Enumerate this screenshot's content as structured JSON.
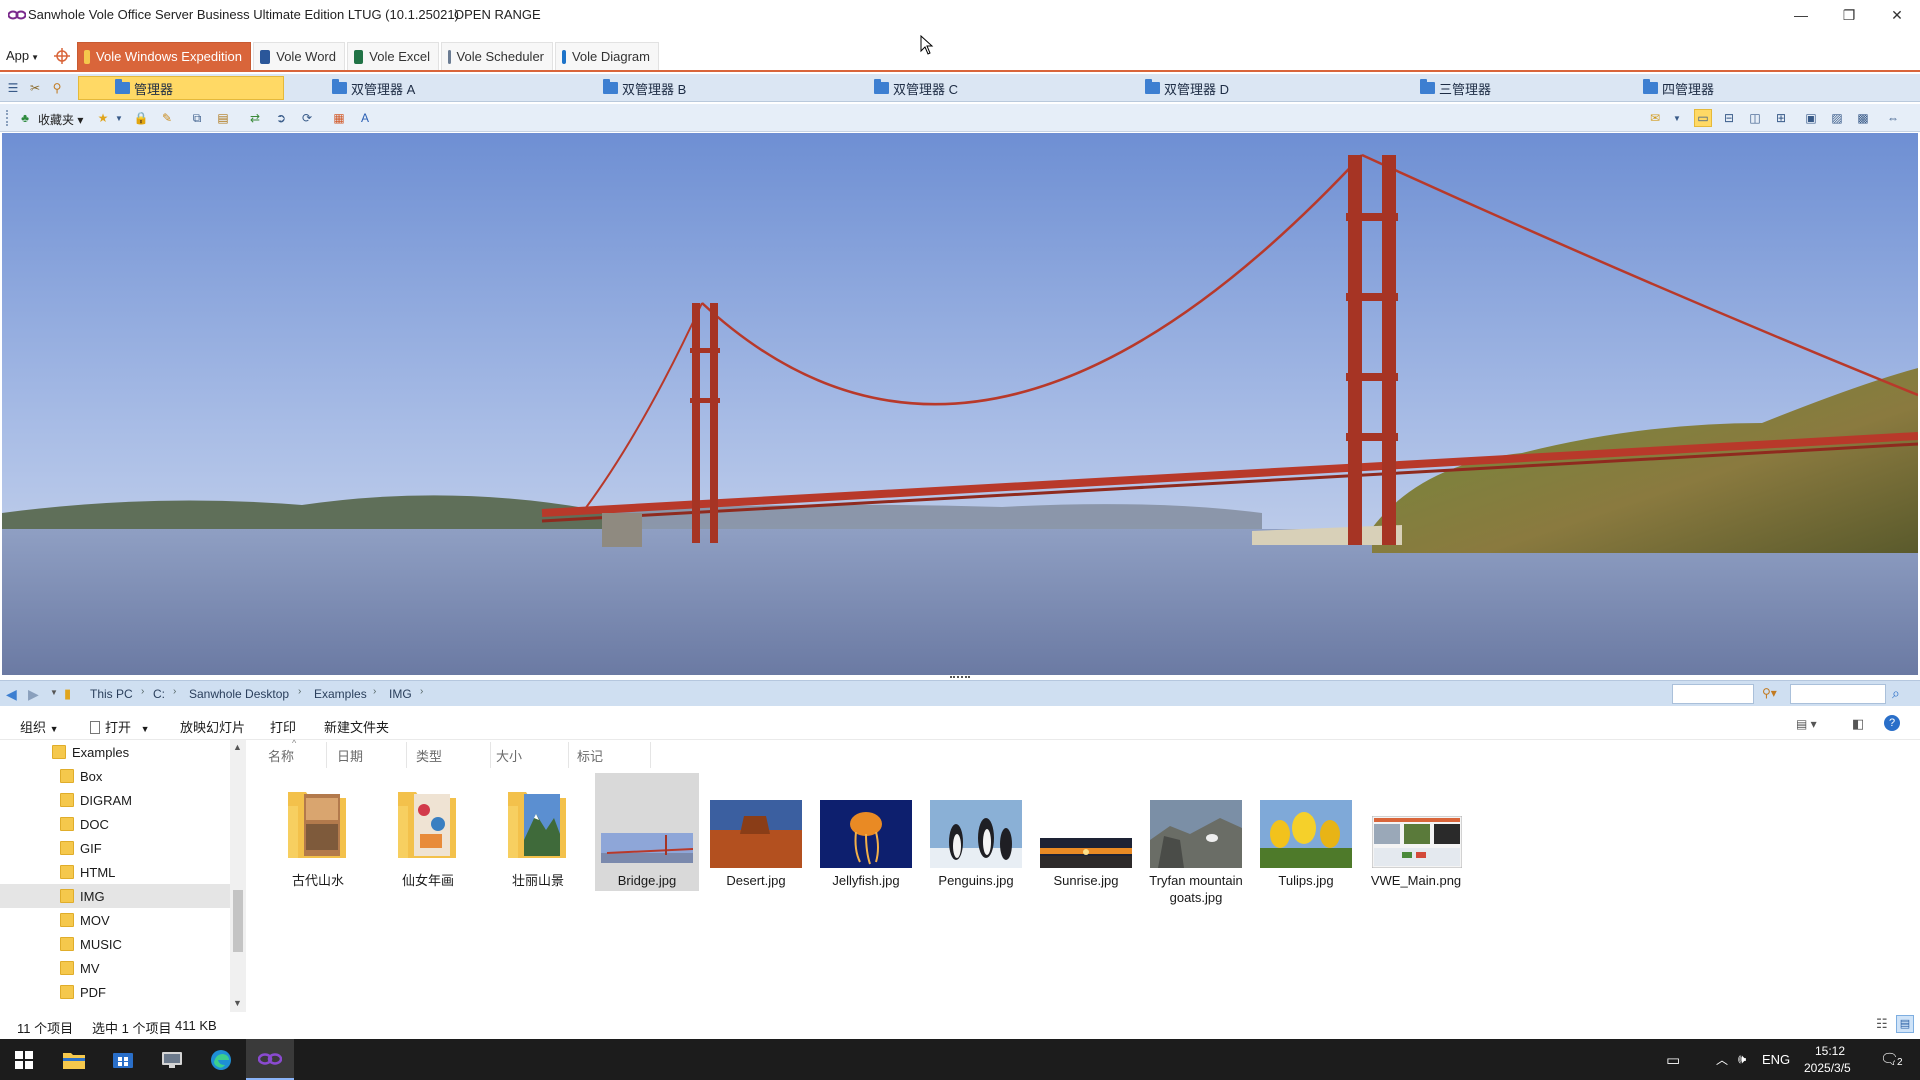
{
  "window": {
    "title": "Sanwhole Vole Office Server Business Ultimate Edition LTUG (10.1.25021)",
    "subtitle": "OPEN RANGE",
    "controls": {
      "minimize": "—",
      "restore": "❐",
      "close": "✕"
    }
  },
  "menubar": {
    "app_label": "App",
    "tabs": [
      {
        "label": "Vole Windows Expedition",
        "color": "#f5c84c"
      },
      {
        "label": "Vole Word",
        "color": "#2b579a"
      },
      {
        "label": "Vole Excel",
        "color": "#217346"
      },
      {
        "label": "Vole Scheduler",
        "color": "#6b7c93"
      },
      {
        "label": "Vole Diagram",
        "color": "#1d73c9"
      }
    ]
  },
  "managers": [
    {
      "label": "管理器"
    },
    {
      "label": "双管理器 A"
    },
    {
      "label": "双管理器 B"
    },
    {
      "label": "双管理器 C"
    },
    {
      "label": "双管理器 D"
    },
    {
      "label": "三管理器"
    },
    {
      "label": "四管理器"
    }
  ],
  "toolbar": {
    "favorites_label": "收藏夹"
  },
  "address": {
    "crumbs": [
      "This PC",
      "C:",
      "Sanwhole Desktop",
      "Examples",
      "IMG"
    ]
  },
  "commands": {
    "organize": "组织",
    "open": "打开",
    "slideshow": "放映幻灯片",
    "print": "打印",
    "new_folder": "新建文件夹"
  },
  "tree": {
    "root": "Examples",
    "items": [
      "Box",
      "DIGRAM",
      "DOC",
      "GIF",
      "HTML",
      "IMG",
      "MOV",
      "MUSIC",
      "MV",
      "PDF"
    ],
    "selected": "IMG"
  },
  "columns": [
    "名称",
    "日期",
    "类型",
    "大小",
    "标记"
  ],
  "files": [
    {
      "name": "古代山水",
      "kind": "folder"
    },
    {
      "name": "仙女年画",
      "kind": "folder"
    },
    {
      "name": "壮丽山景",
      "kind": "folder"
    },
    {
      "name": "Bridge.jpg",
      "kind": "image",
      "selected": true
    },
    {
      "name": "Desert.jpg",
      "kind": "image"
    },
    {
      "name": "Jellyfish.jpg",
      "kind": "image"
    },
    {
      "name": "Penguins.jpg",
      "kind": "image"
    },
    {
      "name": "Sunrise.jpg",
      "kind": "image"
    },
    {
      "name": "Tryfan mountain goats.jpg",
      "kind": "image"
    },
    {
      "name": "Tulips.jpg",
      "kind": "image"
    },
    {
      "name": "VWE_Main.png",
      "kind": "image"
    }
  ],
  "status": {
    "count": "11 个项目",
    "selection": "选中 1 个项目",
    "size": "411 KB"
  },
  "taskbar": {
    "language": "ENG",
    "time": "15:12",
    "date": "2025/3/5",
    "notifications": "2"
  },
  "colors": {
    "accent": "#d9653a",
    "manager_active": "#ffd965",
    "manager_bar": "#dbe6f3",
    "address_bar": "#cfdff1"
  }
}
